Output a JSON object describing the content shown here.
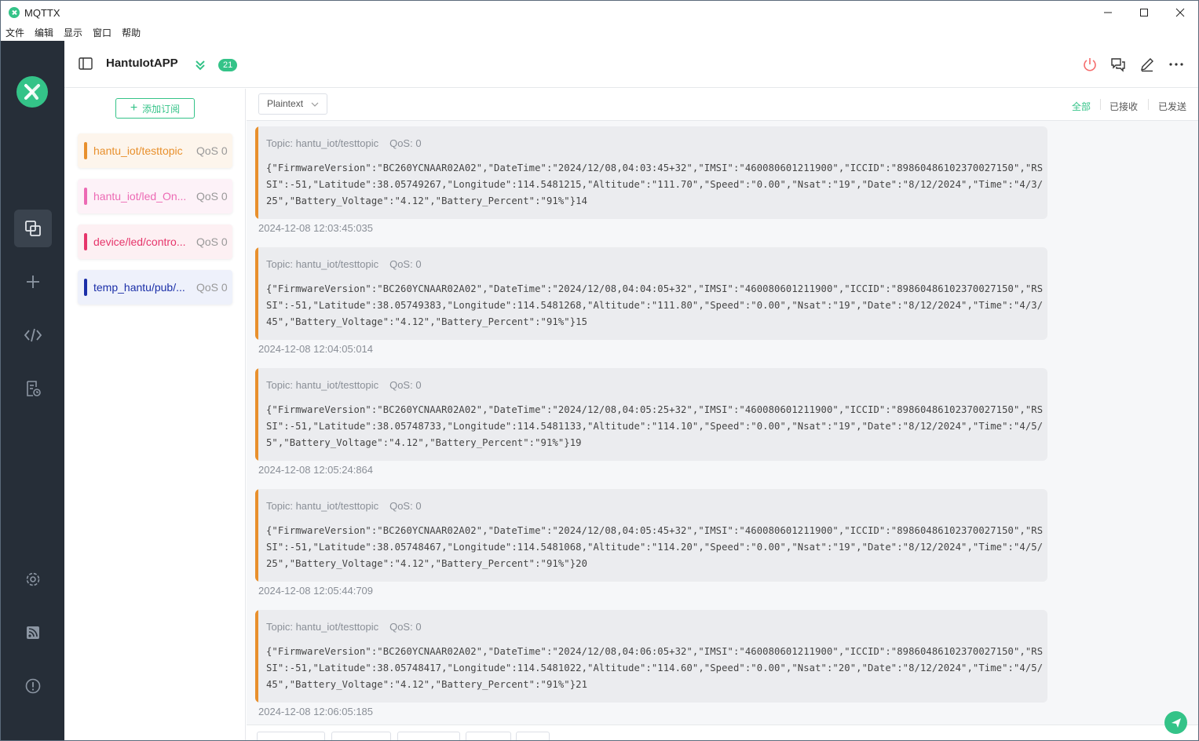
{
  "window": {
    "title": "MQTTX",
    "controls": [
      "minimize",
      "maximize",
      "close"
    ]
  },
  "menubar": [
    "文件",
    "编辑",
    "显示",
    "窗口",
    "帮助"
  ],
  "nav": {
    "items": [
      "connections-icon",
      "new-connection-icon",
      "script-icon",
      "log-icon",
      "settings-icon",
      "feed-icon",
      "about-icon"
    ],
    "active": "connections-icon"
  },
  "header": {
    "connection_name": "HantuIotAPP",
    "message_count": "21",
    "accent_color": "#34c388"
  },
  "subscriptions": {
    "add_label": "添加订阅",
    "items": [
      {
        "topic": "hantu_iot/testtopic",
        "qos": "QoS 0",
        "color": "#e8902d",
        "bg": "#fdf5ec"
      },
      {
        "topic": "hantu_iot/led_On...",
        "qos": "QoS 0",
        "color": "#ec6ab4",
        "bg": "#fdf2f8"
      },
      {
        "topic": "device/led/contro...",
        "qos": "QoS 0",
        "color": "#e6356b",
        "bg": "#fdf0f3"
      },
      {
        "topic": "temp_hantu/pub/...",
        "qos": "QoS 0",
        "color": "#1b2fa8",
        "bg": "#eef1fb"
      }
    ]
  },
  "toolbar": {
    "format": "Plaintext",
    "filters": [
      "全部",
      "已接收",
      "已发送"
    ],
    "active_filter": "全部"
  },
  "messages": [
    {
      "topic": "Topic: hantu_iot/testtopic",
      "qos": "QoS: 0",
      "payload": "{\"FirmwareVersion\":\"BC260YCNAAR02A02\",\"DateTime\":\"2024/12/08,04:03:45+32\",\"IMSI\":\"460080601211900\",\"ICCID\":\"89860486102370027150\",\"RSSI\":-51,\"Latitude\":38.05749267,\"Longitude\":114.5481215,\"Altitude\":\"111.70\",\"Speed\":\"0.00\",\"Nsat\":\"19\",\"Date\":\"8/12/2024\",\"Time\":\"4/3/25\",\"Battery_Voltage\":\"4.12\",\"Battery_Percent\":\"91%\"}14",
      "time": "2024-12-08 12:03:45:035"
    },
    {
      "topic": "Topic: hantu_iot/testtopic",
      "qos": "QoS: 0",
      "payload": "{\"FirmwareVersion\":\"BC260YCNAAR02A02\",\"DateTime\":\"2024/12/08,04:04:05+32\",\"IMSI\":\"460080601211900\",\"ICCID\":\"89860486102370027150\",\"RSSI\":-51,\"Latitude\":38.05749383,\"Longitude\":114.5481268,\"Altitude\":\"111.80\",\"Speed\":\"0.00\",\"Nsat\":\"19\",\"Date\":\"8/12/2024\",\"Time\":\"4/3/45\",\"Battery_Voltage\":\"4.12\",\"Battery_Percent\":\"91%\"}15",
      "time": "2024-12-08 12:04:05:014"
    },
    {
      "topic": "Topic: hantu_iot/testtopic",
      "qos": "QoS: 0",
      "payload": "{\"FirmwareVersion\":\"BC260YCNAAR02A02\",\"DateTime\":\"2024/12/08,04:05:25+32\",\"IMSI\":\"460080601211900\",\"ICCID\":\"89860486102370027150\",\"RSSI\":-51,\"Latitude\":38.05748733,\"Longitude\":114.5481133,\"Altitude\":\"114.10\",\"Speed\":\"0.00\",\"Nsat\":\"19\",\"Date\":\"8/12/2024\",\"Time\":\"4/5/5\",\"Battery_Voltage\":\"4.12\",\"Battery_Percent\":\"91%\"}19",
      "time": "2024-12-08 12:05:24:864"
    },
    {
      "topic": "Topic: hantu_iot/testtopic",
      "qos": "QoS: 0",
      "payload": "{\"FirmwareVersion\":\"BC260YCNAAR02A02\",\"DateTime\":\"2024/12/08,04:05:45+32\",\"IMSI\":\"460080601211900\",\"ICCID\":\"89860486102370027150\",\"RSSI\":-51,\"Latitude\":38.05748467,\"Longitude\":114.5481068,\"Altitude\":\"114.20\",\"Speed\":\"0.00\",\"Nsat\":\"19\",\"Date\":\"8/12/2024\",\"Time\":\"4/5/25\",\"Battery_Voltage\":\"4.12\",\"Battery_Percent\":\"91%\"}20",
      "time": "2024-12-08 12:05:44:709"
    },
    {
      "topic": "Topic: hantu_iot/testtopic",
      "qos": "QoS: 0",
      "payload": "{\"FirmwareVersion\":\"BC260YCNAAR02A02\",\"DateTime\":\"2024/12/08,04:06:05+32\",\"IMSI\":\"460080601211900\",\"ICCID\":\"89860486102370027150\",\"RSSI\":-51,\"Latitude\":38.05748417,\"Longitude\":114.5481022,\"Altitude\":\"114.60\",\"Speed\":\"0.00\",\"Nsat\":\"20\",\"Date\":\"8/12/2024\",\"Time\":\"4/5/45\",\"Battery_Voltage\":\"4.12\",\"Battery_Percent\":\"91%\"}21",
      "time": "2024-12-08 12:06:05:185"
    }
  ]
}
